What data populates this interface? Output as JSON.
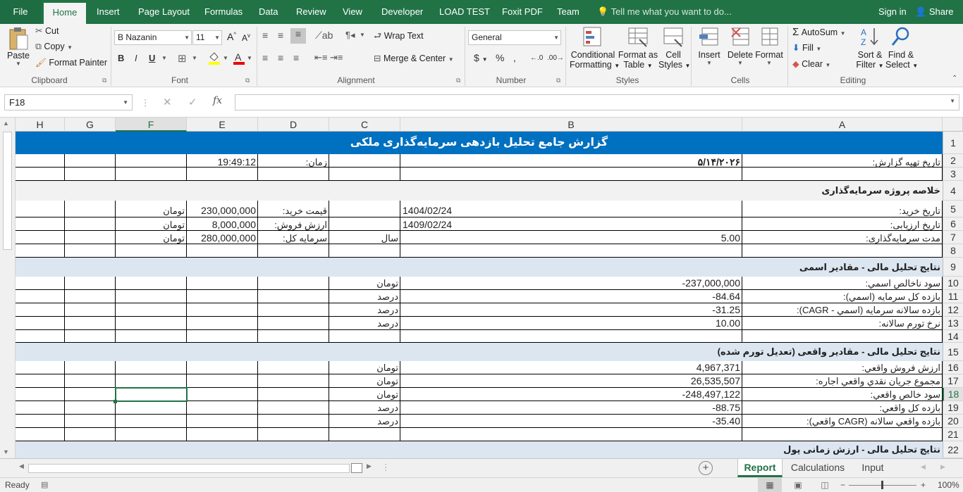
{
  "tabs": {
    "file": "File",
    "home": "Home",
    "insert": "Insert",
    "page_layout": "Page Layout",
    "formulas": "Formulas",
    "data": "Data",
    "review": "Review",
    "view": "View",
    "developer": "Developer",
    "load_test": "LOAD TEST",
    "foxit": "Foxit PDF",
    "team": "Team",
    "tell_me": "Tell me what you want to do...",
    "sign_in": "Sign in",
    "share": "Share"
  },
  "ribbon": {
    "paste": "Paste",
    "cut": "Cut",
    "copy": "Copy",
    "format_painter": "Format Painter",
    "clipboard": "Clipboard",
    "font_name": "B Nazanin",
    "font_size": "11",
    "font": "Font",
    "wrap_text": "Wrap Text",
    "merge_center": "Merge & Center",
    "alignment": "Alignment",
    "number_format": "General",
    "number": "Number",
    "conditional_formatting_1": "Conditional",
    "conditional_formatting_2": "Formatting",
    "format_as_table_1": "Format as",
    "format_as_table_2": "Table",
    "cell_styles_1": "Cell",
    "cell_styles_2": "Styles",
    "styles": "Styles",
    "insert": "Insert",
    "delete": "Delete",
    "format": "Format",
    "cells": "Cells",
    "autosum": "AutoSum",
    "fill": "Fill",
    "clear": "Clear",
    "sort_filter_1": "Sort &",
    "sort_filter_2": "Filter",
    "find_select_1": "Find &",
    "find_select_2": "Select",
    "editing": "Editing"
  },
  "formula_bar": {
    "name_box": "F18",
    "formula": ""
  },
  "columns": [
    "H",
    "G",
    "F",
    "E",
    "D",
    "C",
    "B",
    "A"
  ],
  "rows": [
    "1",
    "2",
    "3",
    "4",
    "5",
    "6",
    "7",
    "8",
    "9",
    "10",
    "11",
    "12",
    "13",
    "14",
    "15",
    "16",
    "17",
    "18",
    "19",
    "20",
    "21",
    "22"
  ],
  "sheet": {
    "title": "گزارش جامع تحلیل بازدهی سرمایه‌گذاری ملکی",
    "r2": {
      "a": "تاریخ تهیه گزارش:",
      "b": "۵/۱۴/۲۰۲۶",
      "d": "زمان:",
      "e": "19:49:12"
    },
    "r4": {
      "a": "خلاصه پروژه سرمایه‌گذاری"
    },
    "r5": {
      "a": "تاریخ خرید:",
      "c": "1404/02/24",
      "d": "قیمت خرید:",
      "e": "230,000,000",
      "f": "تومان"
    },
    "r6": {
      "a": "تاریخ ارزیابی:",
      "c": "1409/02/24",
      "d": "ارزش فروش:",
      "e": "8,000,000",
      "f": "تومان"
    },
    "r7": {
      "a": "مدت سرمایه‌گذاری:",
      "b": "5.00",
      "c": "سال",
      "d": "سرمایه کل:",
      "e": "280,000,000",
      "f": "تومان"
    },
    "r9": {
      "a": "نتایج تحلیل مالی - مقادیر اسمی"
    },
    "r10": {
      "a": "سود ناخالص اسمي:",
      "b": "-237,000,000",
      "c": "تومان"
    },
    "r11": {
      "a": "بازده کل سرمایه (اسمي):",
      "b": "-84.64",
      "c": "درصد"
    },
    "r12": {
      "a": "بازده سالانه سرمایه (اسمي - CAGR):",
      "b": "-31.25",
      "c": "درصد"
    },
    "r13": {
      "a": "نرخ تورم سالانه:",
      "b": "10.00",
      "c": "درصد"
    },
    "r15": {
      "a": "نتایج تحلیل مالی - مقادیر واقعی (تعدیل تورم شده)"
    },
    "r16": {
      "a": "ارزش فروش واقعي:",
      "b": "4,967,371",
      "c": "تومان"
    },
    "r17": {
      "a": "مجموع جریان نقدي واقعي اجاره:",
      "b": "26,535,507",
      "c": "تومان"
    },
    "r18": {
      "a": "سود خالص واقعي:",
      "b": "-248,497,122",
      "c": "تومان"
    },
    "r19": {
      "a": "بازده کل واقعي:",
      "b": "-88.75",
      "c": "درصد"
    },
    "r20": {
      "a": "بازده واقعي سالانه (CAGR واقعي):",
      "b": "-35.40",
      "c": "درصد"
    },
    "r22": {
      "a": "نتایج تحلیل مالی - ارزش زمانی پول"
    }
  },
  "sheet_tabs": [
    "Report",
    "Calculations",
    "Input"
  ],
  "status": {
    "ready": "Ready",
    "zoom": "100%"
  },
  "colors": {
    "excel_green": "#217346",
    "title_band": "#0070c0",
    "section_band": "#dce6f1",
    "summary_band": "#f2f2f2"
  }
}
